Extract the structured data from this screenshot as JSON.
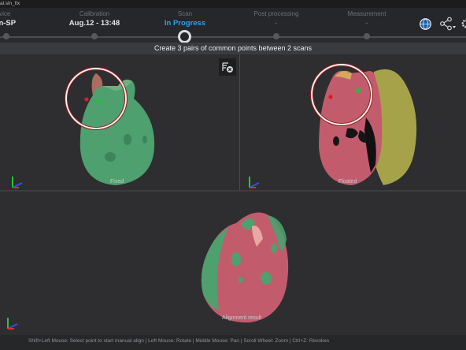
{
  "window": {
    "title": "al.sln_fix"
  },
  "steps": [
    {
      "caption": "evice",
      "value": "can-SP",
      "state": "done"
    },
    {
      "caption": "Calibration",
      "value": "Aug.12 - 13:48",
      "state": "done"
    },
    {
      "caption": "Scan",
      "value": "In Progress",
      "state": "active"
    },
    {
      "caption": "Post processing",
      "value": "-",
      "state": "pending"
    },
    {
      "caption": "Measurement",
      "value": "-",
      "state": "pending"
    }
  ],
  "toolbar_icons": [
    "globe-icon",
    "share-icon",
    "settings-icon"
  ],
  "banner": {
    "text": "Create 3 pairs of common points between 2 scans"
  },
  "views": {
    "fixed": {
      "label": "Fixed"
    },
    "floated": {
      "label": "Floated"
    },
    "result": {
      "label": "Alignment result"
    }
  },
  "status": {
    "hint": "Shift+Left Mouse: Select point to start manual align | Left Mouse: Rotate | Middle Mouse: Pan | Scroll Wheel: Zoom | Ctrl+Z: Revokes"
  },
  "colors": {
    "accent": "#2aa1ef",
    "marker_red": "#d81e1e",
    "marker_green": "#1fc13a",
    "scan_green": "#4ea06e",
    "scan_pink": "#c25c6d",
    "scan_yellow": "#a6a24a"
  }
}
